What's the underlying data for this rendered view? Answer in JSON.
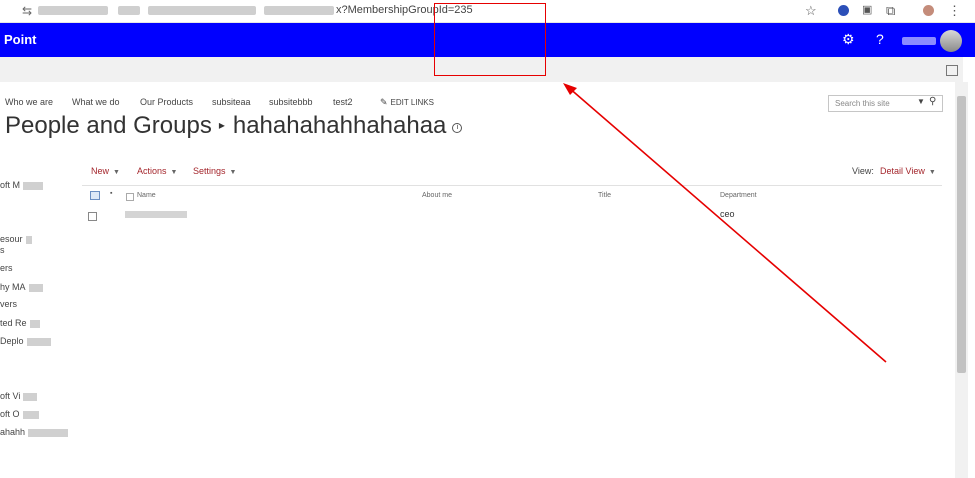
{
  "browser": {
    "url_visible": "x?MembershipGroupId=235"
  },
  "suite": {
    "brand": "Point"
  },
  "top_nav": {
    "items": [
      "Who we are",
      "What we do",
      "Our Products",
      "subsiteaa",
      "subsitebbb",
      "test2"
    ],
    "edit_links": "EDIT LINKS"
  },
  "search": {
    "placeholder": "Search this site"
  },
  "title": {
    "section": "People and Groups",
    "group": "hahahahahhahahaa"
  },
  "left_nav": {
    "items": [
      "oft M",
      "esour",
      "s",
      "ers",
      "hy MA",
      "vers",
      "ted Re",
      "Deplo",
      "oft Vi",
      "oft O",
      "ahahh"
    ]
  },
  "toolbar": {
    "new": "New",
    "actions": "Actions",
    "settings": "Settings",
    "view_label": "View:",
    "view_value": "Detail View"
  },
  "table": {
    "columns": [
      "Name",
      "About me",
      "Title",
      "Department"
    ],
    "rows": [
      {
        "name": "",
        "about": "",
        "title": "",
        "department": "ceo"
      }
    ]
  },
  "colors": {
    "suite_bar": "#0000ff",
    "link_accent": "#a4262c",
    "annotation": "#e60000"
  }
}
